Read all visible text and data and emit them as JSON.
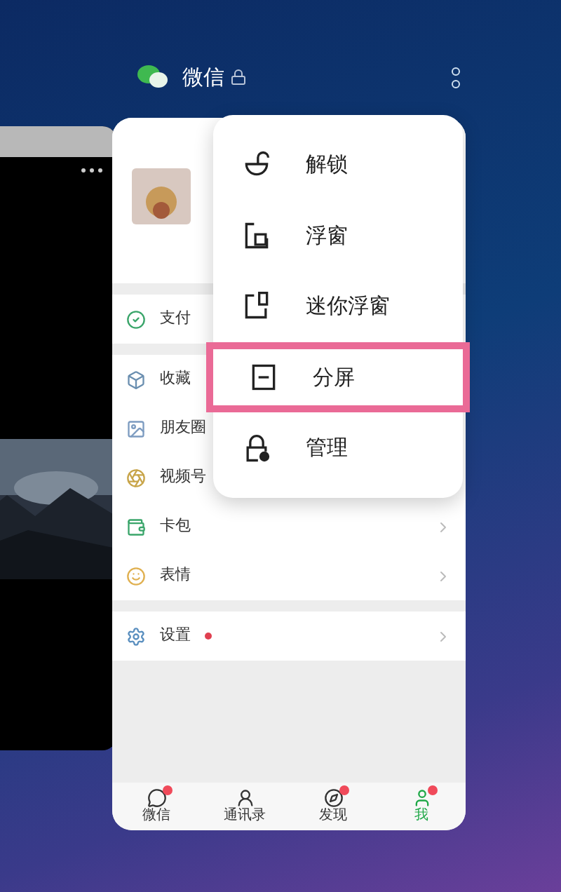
{
  "header": {
    "app_name": "微信",
    "locked": true
  },
  "sections": [
    [
      {
        "kind": "pay",
        "label": "支付"
      }
    ],
    [
      {
        "kind": "favorites",
        "label": "收藏"
      },
      {
        "kind": "moments",
        "label": "朋友圈"
      },
      {
        "kind": "channels",
        "label": "视频号"
      },
      {
        "kind": "cards",
        "label": "卡包",
        "chevron": true
      },
      {
        "kind": "stickers",
        "label": "表情",
        "chevron": true
      }
    ],
    [
      {
        "kind": "settings",
        "label": "设置",
        "chevron": true,
        "dot": true
      }
    ]
  ],
  "tabs": [
    {
      "kind": "chats",
      "label": "微信",
      "selected": false,
      "badge": true
    },
    {
      "kind": "contacts",
      "label": "通讯录",
      "selected": false,
      "badge": false
    },
    {
      "kind": "discover",
      "label": "发现",
      "selected": false,
      "badge": true
    },
    {
      "kind": "me",
      "label": "我",
      "selected": true,
      "badge": true
    }
  ],
  "menu": [
    {
      "kind": "unlock",
      "label": "解锁",
      "selected": false
    },
    {
      "kind": "float",
      "label": "浮窗",
      "selected": false
    },
    {
      "kind": "mini",
      "label": "迷你浮窗",
      "selected": false
    },
    {
      "kind": "split",
      "label": "分屏",
      "selected": true
    },
    {
      "kind": "manage",
      "label": "管理",
      "selected": false
    }
  ]
}
